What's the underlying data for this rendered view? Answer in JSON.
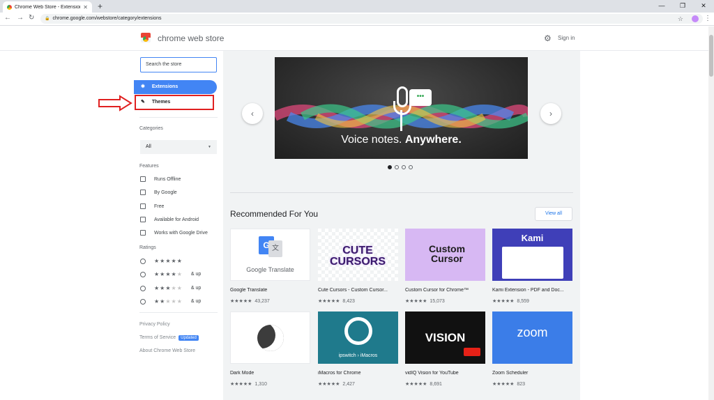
{
  "browser": {
    "tab_title": "Chrome Web Store - Extensions",
    "tab_close": "✕",
    "new_tab": "+",
    "url": "chrome.google.com/webstore/category/extensions",
    "win_min": "—",
    "win_max": "❐",
    "win_close": "✕"
  },
  "header": {
    "brand": "chrome web store",
    "signin": "Sign in"
  },
  "sidebar": {
    "search_placeholder": "Search the store",
    "nav": [
      {
        "label": "Extensions"
      },
      {
        "label": "Themes"
      }
    ],
    "categories_title": "Categories",
    "category_selected": "All",
    "features_title": "Features",
    "features": [
      "Runs Offline",
      "By Google",
      "Free",
      "Available for Android",
      "Works with Google Drive"
    ],
    "ratings_title": "Ratings",
    "ratings": [
      {
        "on": "★★★★★",
        "off": "",
        "suffix": ""
      },
      {
        "on": "★★★★",
        "off": "★",
        "suffix": "& up"
      },
      {
        "on": "★★★",
        "off": "★★",
        "suffix": "& up"
      },
      {
        "on": "★★",
        "off": "★★★",
        "suffix": "& up"
      }
    ],
    "footer": {
      "privacy": "Privacy Policy",
      "terms": "Terms of Service",
      "updated": "Updated",
      "about": "About Chrome Web Store"
    }
  },
  "hero": {
    "text_regular": "Voice notes.",
    "text_bold": "Anywhere.",
    "bubble": "•••",
    "prev": "‹",
    "next": "›"
  },
  "recommended": {
    "title": "Recommended For You",
    "view_all": "View all",
    "items": [
      {
        "name": "Google Translate",
        "rating": "★★★★★",
        "count": "43,237",
        "thumb_text": "Google Translate"
      },
      {
        "name": "Cute Cursors - Custom Cursor...",
        "rating": "★★★★★",
        "count": "8,423",
        "thumb_text": "CUTE CURSORS"
      },
      {
        "name": "Custom Cursor for Chrome™",
        "rating": "★★★★★",
        "count": "15,073",
        "thumb_text": "Custom Cursor"
      },
      {
        "name": "Kami Extension - PDF and Doc...",
        "rating": "★★★★★",
        "count": "8,559",
        "thumb_text": "Kami"
      },
      {
        "name": "Dark Mode",
        "rating": "★★★★★",
        "count": "1,310",
        "thumb_text": ""
      },
      {
        "name": "iMacros for Chrome",
        "rating": "★★★★★",
        "count": "2,427",
        "thumb_text": "ipswitch › iMacros"
      },
      {
        "name": "vidIQ Vision for YouTube",
        "rating": "★★★★★",
        "count": "8,691",
        "thumb_text": "VISION"
      },
      {
        "name": "Zoom Scheduler",
        "rating": "★★★★★",
        "count": "823",
        "thumb_text": "zoom"
      }
    ]
  },
  "colors": {
    "accent": "#4285f4",
    "highlight_box": "#e02020"
  }
}
